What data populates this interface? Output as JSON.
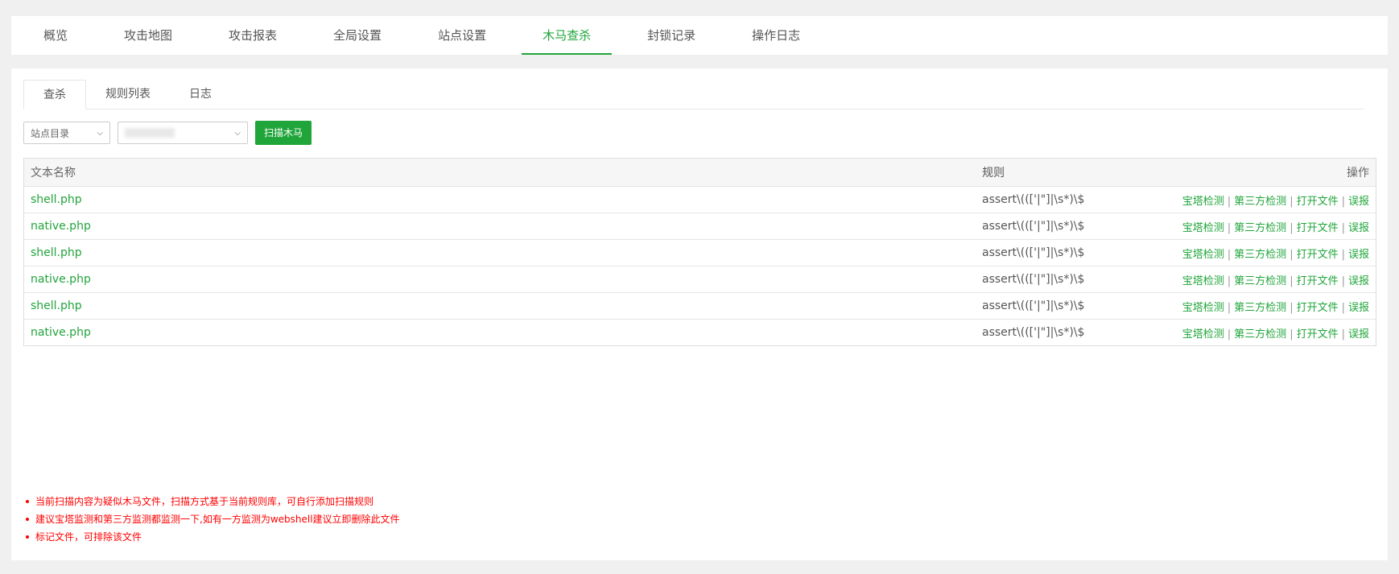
{
  "top_tabs": [
    "概览",
    "攻击地图",
    "攻击报表",
    "全局设置",
    "站点设置",
    "木马查杀",
    "封锁记录",
    "操作日志"
  ],
  "top_active": "木马查杀",
  "sub_tabs": [
    "查杀",
    "规则列表",
    "日志"
  ],
  "toolbar": {
    "dir_select": "站点目录",
    "scan_button": "扫描木马"
  },
  "table": {
    "headers": {
      "name": "文本名称",
      "rule": "规则",
      "ops": "操作"
    },
    "rows": [
      {
        "name": "shell.php",
        "rule": "assert\\((['|\"]|\\s*)\\$"
      },
      {
        "name": "native.php",
        "rule": "assert\\((['|\"]|\\s*)\\$"
      },
      {
        "name": "shell.php",
        "rule": "assert\\((['|\"]|\\s*)\\$"
      },
      {
        "name": "native.php",
        "rule": "assert\\((['|\"]|\\s*)\\$"
      },
      {
        "name": "shell.php",
        "rule": "assert\\((['|\"]|\\s*)\\$"
      },
      {
        "name": "native.php",
        "rule": "assert\\((['|\"]|\\s*)\\$"
      }
    ],
    "actions": [
      "宝塔检测",
      "第三方检测",
      "打开文件",
      "误报"
    ]
  },
  "tips": [
    "当前扫描内容为疑似木马文件，扫描方式基于当前规则库，可自行添加扫描规则",
    "建议宝塔监测和第三方监测都监测一下,如有一方监测为webshell建议立即删除此文件",
    "标记文件，可排除该文件"
  ],
  "colors": {
    "accent": "#20a53a",
    "warning": "#ff0000"
  }
}
